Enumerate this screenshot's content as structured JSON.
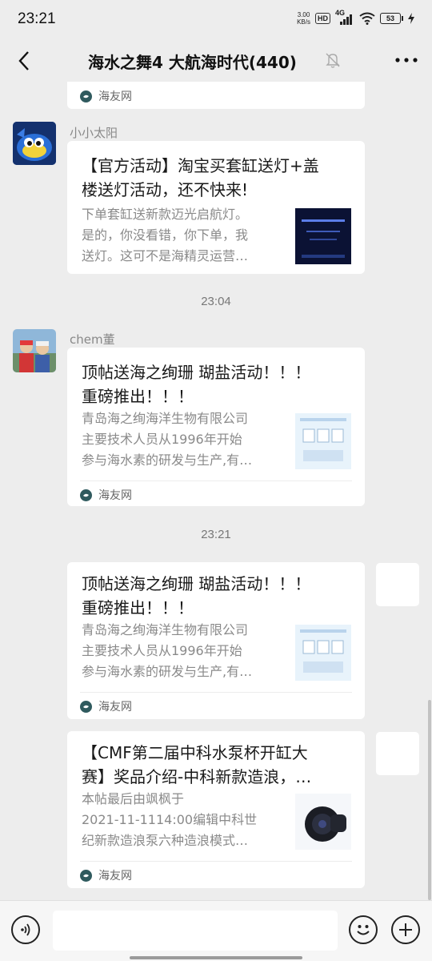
{
  "status_bar": {
    "time": "23:21",
    "net_speed_value": "3.00",
    "net_speed_unit": "KB/s",
    "hd_label": "HD",
    "network_label": "4G",
    "battery_level": "53"
  },
  "header": {
    "title": "海水之舞4 大航海时代(440)",
    "back_icon": "chevron-left-icon",
    "mute_icon": "bell-muted-icon",
    "more_icon": "more-dots-icon"
  },
  "messages": [
    {
      "type": "card-partial",
      "source": "海友网"
    },
    {
      "type": "card",
      "sender": "小小太阳",
      "title_lines": [
        "【官方活动】淘宝买套缸送灯+盖",
        "楼送灯活动，还不快来!"
      ],
      "desc_lines": [
        "下单套缸送新款迈光启航灯。",
        "是的，你没看错，你下单，我",
        "送灯。这可不是海精灵运营…"
      ],
      "thumb_text": "迈光启航新品"
    },
    {
      "type": "time",
      "text": "23:04"
    },
    {
      "type": "card",
      "sender": "chem董",
      "title_lines": [
        "顶帖送海之绚珊 瑚盐活动！！！",
        "重磅推出！！！"
      ],
      "desc_lines": [
        "青岛海之绚海洋生物有限公司",
        "主要技术人员从1996年开始",
        "参与海水素的研发与生产,有…"
      ],
      "source": "海友网"
    },
    {
      "type": "time",
      "text": "23:21"
    },
    {
      "type": "card-self",
      "title_lines": [
        "顶帖送海之绚珊 瑚盐活动！！！",
        "重磅推出！！！"
      ],
      "desc_lines": [
        "青岛海之绚海洋生物有限公司",
        "主要技术人员从1996年开始",
        "参与海水素的研发与生产,有…"
      ],
      "source": "海友网"
    },
    {
      "type": "card-self",
      "title_lines": [
        "【CMF第二届中科水泵杯开缸大",
        "赛】奖品介绍-中科新款造浪，…"
      ],
      "desc_lines": [
        "本帖最后由飒枫于",
        "2021-11-1114:00编辑中科世",
        "纪新款造浪泵六种造浪模式…"
      ],
      "source": "海友网"
    }
  ],
  "input_bar": {
    "voice_icon": "voice-icon",
    "emoji_icon": "emoji-icon",
    "plus_icon": "plus-icon"
  }
}
